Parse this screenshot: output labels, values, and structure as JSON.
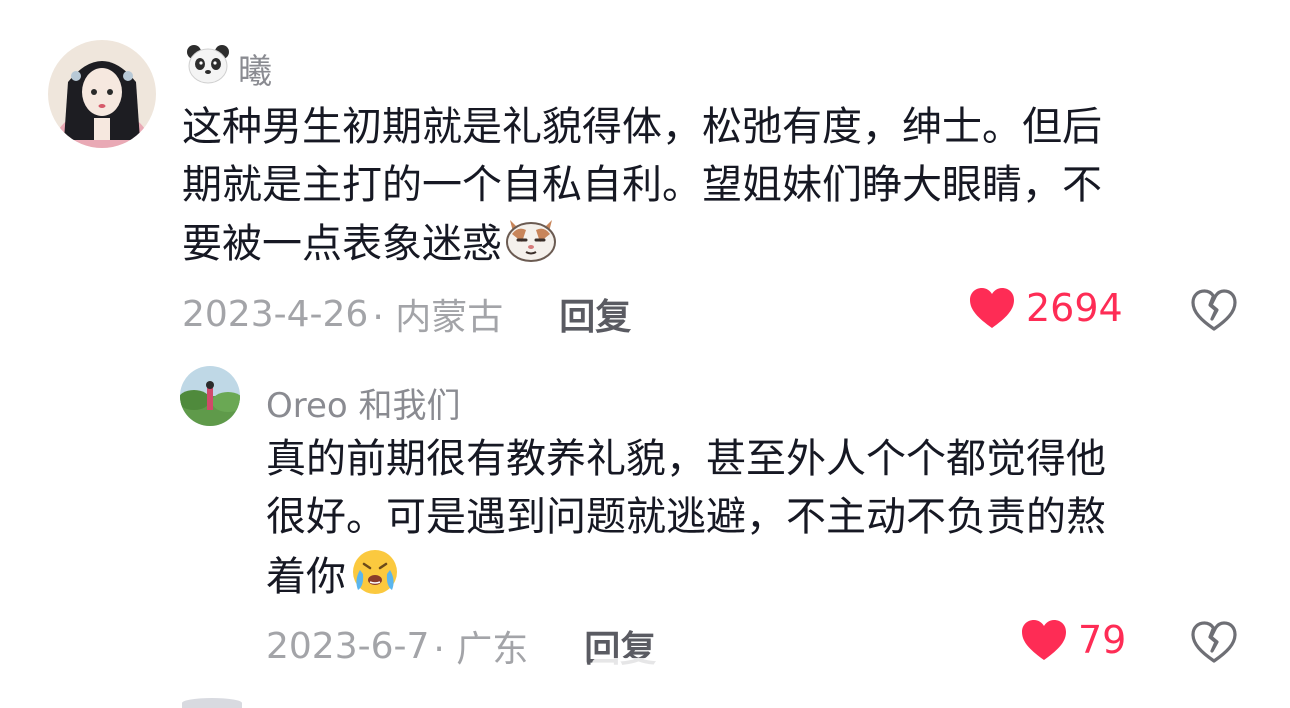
{
  "comments": [
    {
      "username": "曦",
      "username_icon": "panda-emoji",
      "text": "这种男生初期就是礼貌得体，松弛有度，绅士。但后期就是主打的一个自私自利。望姐妹们睁大眼睛，不要被一点表象迷惑",
      "lines": [
        "这种男生初期就是礼貌得体，松弛有度，绅士。但后",
        "期就是主打的一个自私自利。望姐妹们睁大眼睛，不",
        "要被一点表象迷惑"
      ],
      "emoji": "smug-cat-emoji",
      "date": "2023-4-26",
      "location": "· 内蒙古",
      "reply_label": "回复",
      "like_count": "2694",
      "like_color": "#fe2c55"
    },
    {
      "username": "Oreo 和我们",
      "lines": [
        "真的前期很有教养礼貌，甚至外人个个都觉得他",
        "很好。可是遇到问题就逃避，不主动不负责的熬",
        "着你"
      ],
      "emoji": "crying-face-emoji",
      "date": "2023-6-7",
      "location": "· 广东",
      "reply_label": "回复",
      "like_count": "79",
      "like_color": "#fe2c55"
    }
  ],
  "colors": {
    "meta_gray": "#a3a4a8",
    "username_gray": "#8a8b91",
    "reply_dark": "#5a5b62",
    "like_red": "#fe2c55"
  }
}
